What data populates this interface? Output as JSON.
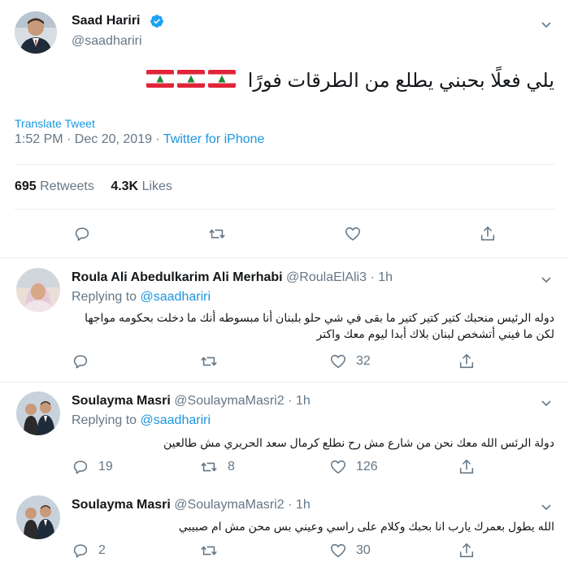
{
  "main_tweet": {
    "author_name": "Saad Hariri",
    "author_handle": "@saadhariri",
    "text": "يلي فعلًا بحبني يطلع من الطرقات فورًا",
    "flags": "🇱🇧🇱🇧🇱🇧",
    "translate_label": "Translate Tweet",
    "timestamp": "1:52 PM · Dec 20, 2019 · ",
    "source": "Twitter for iPhone",
    "retweets_count": "695",
    "retweets_label": "Retweets",
    "likes_count": "4.3K",
    "likes_label": "Likes"
  },
  "replies": [
    {
      "author_name": "Roula Ali Abedulkarim Ali Merhabi",
      "author_handle": "@RoulaElAli3",
      "time": "· 1h",
      "replying_label": "Replying to",
      "replying_to": "@saadhariri",
      "text_line1": "دوله الرئيس منحبك كتير كتير كتير ما بقى في شي حلو بلبنان أنا مبسوطه أنك ما دخلت بحكومه مواجها",
      "text_line2": "لكن ما فيني أتشخص لبنان بلاك أبدا ليوم معك واكتر",
      "reply_count": "",
      "retweet_count": "",
      "like_count": "32"
    },
    {
      "author_name": "Soulayma Masri",
      "author_handle": "@SoulaymaMasri2",
      "time": "· 1h",
      "replying_label": "Replying to",
      "replying_to": "@saadhariri",
      "text_line1": "دولة الرئس الله معك نحن من شارع مش رح نطلع كرمال سعد الحريري مش طالعين",
      "reply_count": "19",
      "retweet_count": "8",
      "like_count": "126"
    },
    {
      "author_name": "Soulayma Masri",
      "author_handle": "@SoulaymaMasri2",
      "time": "· 1h",
      "text_line1": "الله يطول بعمرك يارب انا بحبك وكلام على راسي وعيني بس محن مش ام صبيبي",
      "reply_count": "2",
      "retweet_count": "",
      "like_count": "30"
    }
  ],
  "colors": {
    "link": "#1b95e0",
    "muted": "#657786",
    "divider": "#e6ecf0",
    "verified": "#1da1f2"
  },
  "icons": [
    "chevron-down-icon",
    "verified-icon",
    "reply-icon",
    "retweet-icon",
    "like-icon",
    "share-icon"
  ]
}
